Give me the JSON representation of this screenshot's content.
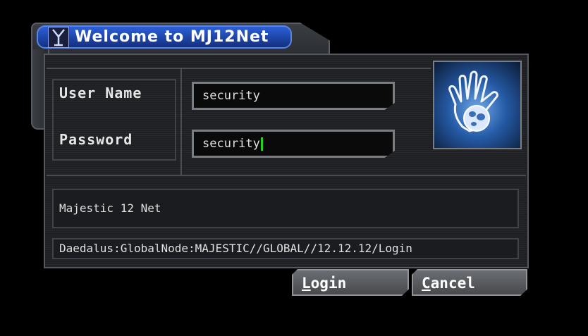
{
  "window": {
    "title": "Welcome to MJ12Net",
    "title_icon": "mj12-logo-icon"
  },
  "form": {
    "user_label": "User Name",
    "password_label": "Password",
    "user_value": "security",
    "password_value": "security"
  },
  "logo": {
    "icon": "hand-globe-logo"
  },
  "message": "Majestic 12 Net",
  "path": "Daedalus:GlobalNode:MAJESTIC//GLOBAL//12.12.12/Login",
  "buttons": {
    "login_first": "L",
    "login_rest": "ogin",
    "cancel_first": "C",
    "cancel_rest": "ancel"
  },
  "colors": {
    "title_bar": "#2c5fd8",
    "caret": "#1fd61f"
  }
}
